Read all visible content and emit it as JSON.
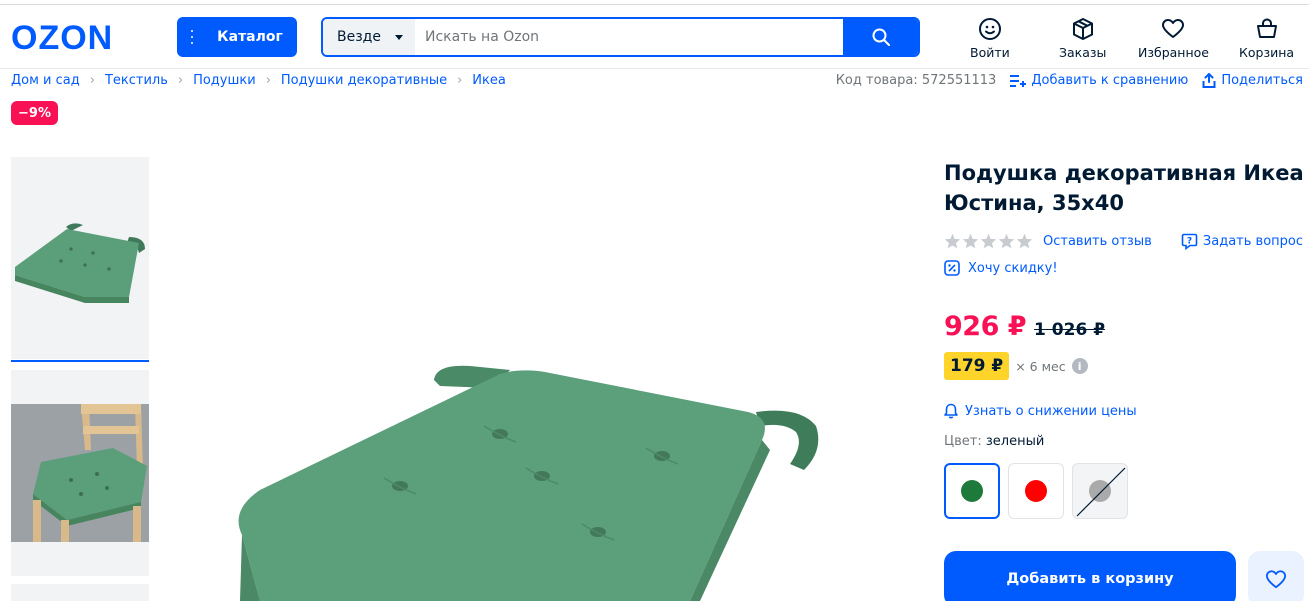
{
  "header": {
    "logo_text": "OZON",
    "catalog_label": "Каталог",
    "search": {
      "scope": "Везде",
      "placeholder": "Искать на Ozon",
      "value": ""
    },
    "nav": [
      {
        "label": "Войти",
        "icon": "smile-icon"
      },
      {
        "label": "Заказы",
        "icon": "box-icon"
      },
      {
        "label": "Избранное",
        "icon": "heart-icon"
      },
      {
        "label": "Корзина",
        "icon": "basket-icon"
      }
    ]
  },
  "breadcrumbs": [
    "Дом и сад",
    "Текстиль",
    "Подушки",
    "Подушки декоративные",
    "Икеа"
  ],
  "meta": {
    "code": "Код товара: 572551113",
    "compare": "Добавить к сравнению",
    "share": "Поделиться"
  },
  "discount_badge": "−9%",
  "product": {
    "title": "Подушка декоративная Икеа Юстина, 35х40",
    "rating_stars": 0,
    "review_link": "Оставить отзыв",
    "ask_question": "Задать вопрос",
    "want_discount": "Хочу скидку!",
    "price": "926 ₽",
    "old_price": "1 026 ₽",
    "installment_price": "179 ₽",
    "installment_term": "× 6 мес",
    "price_alert": "Узнать о снижении цены",
    "color_label": "Цвет:",
    "color_value": "зеленый",
    "colors": [
      {
        "name": "green",
        "hex": "#1e7a3a",
        "available": true
      },
      {
        "name": "red",
        "hex": "#ff0000",
        "available": true
      },
      {
        "name": "gray",
        "hex": "#aaaaaa",
        "available": false
      }
    ],
    "add_to_cart": "Добавить в корзину"
  },
  "colors": {
    "brand_blue": "#005bff",
    "price_red": "#f91155",
    "installment_yellow": "#fed42b",
    "cushion_green": "#5a9e7a"
  }
}
